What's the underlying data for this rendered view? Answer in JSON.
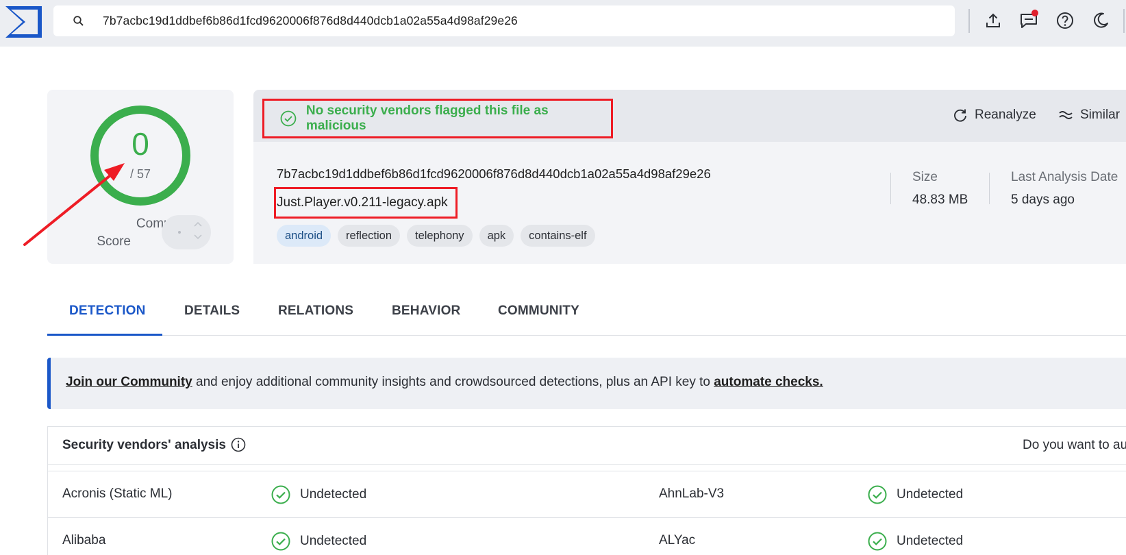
{
  "search": {
    "query": "7b7acbc19d1ddbef6b86d1fcd9620006f876d8d440dcb1a02a55a4d98af29e26",
    "icon": "search-icon"
  },
  "toolbar": {
    "icons": [
      "upload-icon",
      "chat-icon",
      "help-icon",
      "dark-mode-icon"
    ],
    "notification_color": "#e0202d"
  },
  "score": {
    "value": "0",
    "total": "/ 57",
    "community_label_line1": "Community",
    "community_label_line2": "Score",
    "ring_color": "#3bae4d"
  },
  "verdict": {
    "text": "No security vendors flagged this file as malicious",
    "color": "#3bae4d"
  },
  "actions": {
    "reanalyze": "Reanalyze",
    "similar": "Similar"
  },
  "file": {
    "hash": "7b7acbc19d1ddbef6b86d1fcd9620006f876d8d440dcb1a02a55a4d98af29e26",
    "name": "Just.Player.v0.211-legacy.apk",
    "tags": [
      "android",
      "reflection",
      "telephony",
      "apk",
      "contains-elf"
    ],
    "size_label": "Size",
    "size_value": "48.83 MB",
    "date_label": "Last Analysis Date",
    "date_value": "5 days ago"
  },
  "tabs": [
    "DETECTION",
    "DETAILS",
    "RELATIONS",
    "BEHAVIOR",
    "COMMUNITY"
  ],
  "community_banner": {
    "link1": "Join our Community",
    "middle": " and enjoy additional community insights and crowdsourced detections, plus an API key to ",
    "link2": "automate checks."
  },
  "vendors": {
    "title": "Security vendors' analysis",
    "right_text": "Do you want to au",
    "rows": [
      {
        "left_name": "Acronis (Static ML)",
        "left_status": "Undetected",
        "right_name": "AhnLab-V3",
        "right_status": "Undetected"
      },
      {
        "left_name": "Alibaba",
        "left_status": "Undetected",
        "right_name": "ALYac",
        "right_status": "Undetected"
      }
    ]
  },
  "colors": {
    "accent": "#1a57c8",
    "clean": "#3bae4d",
    "highlight": "#ee1c25"
  }
}
